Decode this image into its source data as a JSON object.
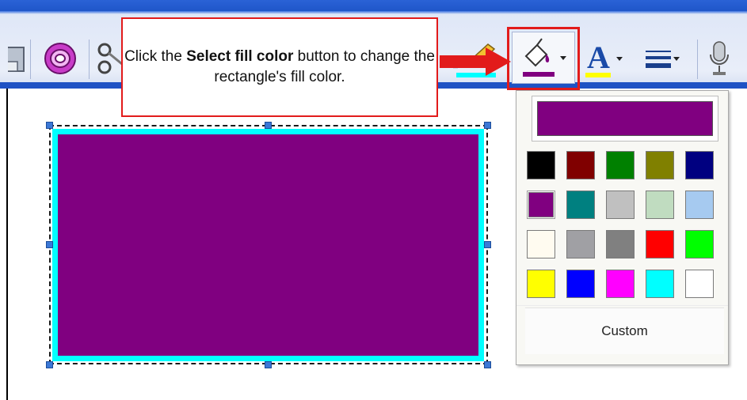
{
  "callout": {
    "text_before": "Click the ",
    "bold_text": "Select fill color",
    "text_after": " button to change the rectangle's fill color."
  },
  "colors": {
    "callout_border": "#e21b1b",
    "rectangle_fill": "#800080",
    "rectangle_outline": "#00ffff",
    "highlight_text_bar": "#00ffff",
    "font_color_bar": "#ffff00"
  },
  "toolbar": {
    "icons": [
      "save-icon",
      "oval-stamp-icon",
      "scissors-icon",
      "highlighter-icon",
      "fill-bucket-icon",
      "font-color-icon",
      "line-style-icon",
      "microphone-icon"
    ]
  },
  "color_panel": {
    "current_color": "#800080",
    "swatches": [
      "#000000",
      "#800000",
      "#008000",
      "#808000",
      "#000080",
      "#800080",
      "#008080",
      "#c0c0c0",
      "#c0dcc0",
      "#a6caf0",
      "#fffbf0",
      "#a0a0a4",
      "#808080",
      "#ff0000",
      "#00ff00",
      "#ffff00",
      "#0000ff",
      "#ff00ff",
      "#00ffff",
      "#ffffff"
    ],
    "selected_index": 5,
    "custom_label": "Custom"
  }
}
